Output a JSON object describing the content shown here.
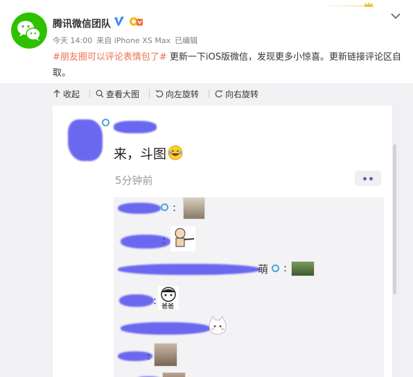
{
  "header": {
    "username": "腾讯微信团队",
    "meta": {
      "time": "今天 14:00",
      "source": "来自 iPhone XS Max",
      "edited": "已编辑"
    },
    "post": {
      "hashtag": "#朋友圈可以评论表情包了#",
      "text": " 更新一下iOS版微信，发现更多小惊喜。更新链接评论区自取。"
    }
  },
  "toolbar": {
    "collapse": "收起",
    "view_large": "查看大图",
    "rotate_left": "向左旋转",
    "rotate_right": "向右旋转"
  },
  "screenshot": {
    "comment": "来，斗图",
    "time_ago": "5分钟前",
    "replies": [
      {
        "suffix": ":"
      },
      {
        "suffix": ":"
      },
      {
        "tail": "萌",
        "suffix": ":"
      },
      {
        "suffix": ":"
      },
      {
        "suffix": ""
      },
      {
        "suffix": ":"
      }
    ],
    "emoji_caption": "爸爸"
  },
  "colors": {
    "accent": "#eb7350",
    "wechat_green": "#2dc100",
    "verified_blue": "#3b8cf7",
    "redaction": "#6b68f0",
    "link_blue": "#576b95"
  },
  "icons": [
    "crown-icon",
    "chevron-down-icon",
    "wechat-logo-icon",
    "verified-icon",
    "vip-icon",
    "collapse-icon",
    "zoom-icon",
    "rotate-left-icon",
    "rotate-right-icon",
    "more-dots-icon"
  ]
}
